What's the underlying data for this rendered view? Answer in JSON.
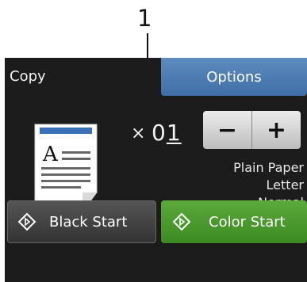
{
  "callout": {
    "number": "1"
  },
  "screen": {
    "title": "Copy",
    "options_label": "Options",
    "copy_count_prefix": "×",
    "copy_count_digit": "0",
    "copy_count_cursor_digit": "1",
    "decrement_label": "−",
    "increment_label": "+",
    "settings": {
      "paper_type": "Plain Paper",
      "paper_size": "Letter",
      "quality": "Normal"
    },
    "black_start_label": "Black Start",
    "color_start_label": "Color Start"
  },
  "colors": {
    "screen_bg": "#1c1c1c",
    "options_button": "#4a7bb5",
    "color_start_button": "#4a9a2e",
    "black_start_button": "#444444"
  }
}
